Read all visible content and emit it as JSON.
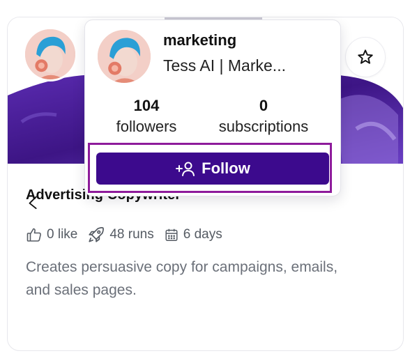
{
  "card": {
    "title": "Advertising Copywriter",
    "likes": "0 like",
    "runs": "48 runs",
    "days": "6 days",
    "description": "Creates persuasive copy for campaigns, emails, and sales pages.",
    "icons": {
      "like": "thumbs-up-icon",
      "runs": "rocket-icon",
      "days": "calendar-icon",
      "favorite": "star-icon",
      "back": "arrow-left-icon"
    },
    "banner_color": "#4a1f9a"
  },
  "popover": {
    "name": "marketing",
    "subtitle": "Tess AI | Marke...",
    "followers_count": "104",
    "followers_label": "followers",
    "subscriptions_count": "0",
    "subscriptions_label": "subscriptions",
    "follow_label": "Follow",
    "follow_icon": "add-user-icon",
    "button_color": "#3c0a8d",
    "highlight_color": "#8e1b9b"
  }
}
